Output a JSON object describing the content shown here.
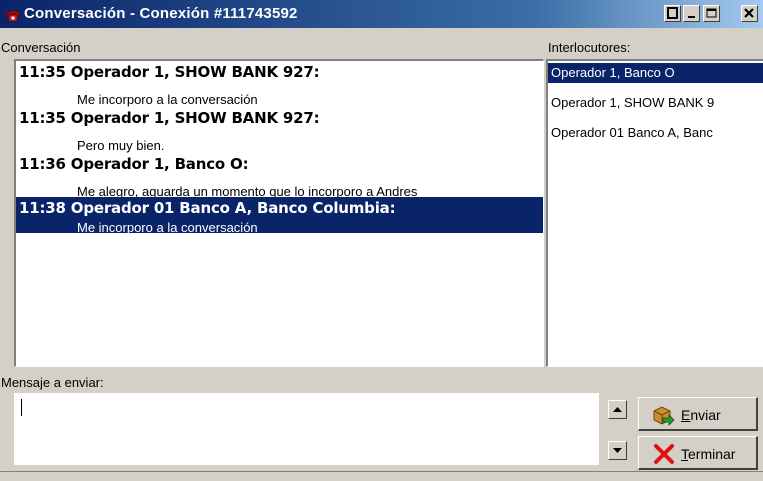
{
  "window": {
    "title": "Conversación - Conexión #111743592",
    "controls": [
      "minimize",
      "restore",
      "maximize",
      "close"
    ]
  },
  "conversation": {
    "label": "Conversación",
    "messages": [
      {
        "time": "11:35",
        "header": "11:35 Operador 1, SHOW BANK 927:",
        "text": "Me incorporo a la conversación",
        "selected": false
      },
      {
        "time": "11:35",
        "header": "11:35 Operador 1, SHOW BANK 927:",
        "text": "Pero muy bien.",
        "selected": false
      },
      {
        "time": "11:36",
        "header": "11:36 Operador 1, Banco O:",
        "text": "Me alegro, aguarda un momento que lo incorporo a Andres",
        "selected": false
      },
      {
        "time": "11:38",
        "header": "11:38 Operador 01 Banco A, Banco Columbia:",
        "text": "Me incorporo a la conversación",
        "selected": true
      }
    ]
  },
  "participants": {
    "label": "Interlocutores:",
    "items": [
      {
        "label": "Operador 1, Banco O",
        "selected": true
      },
      {
        "label": "Operador 1, SHOW BANK 9",
        "selected": false
      },
      {
        "label": "Operador 01 Banco A, Banc",
        "selected": false
      }
    ]
  },
  "compose": {
    "label": "Mensaje a enviar:",
    "value": ""
  },
  "buttons": {
    "send": "Enviar",
    "end": "Terminar"
  },
  "colors": {
    "title_bar": "#0a246a",
    "selection": "#0a246a",
    "face": "#d4d0c8"
  },
  "icons": [
    "telephone-icon",
    "scroll-up-icon",
    "scroll-down-icon",
    "package-send-icon",
    "red-x-icon"
  ]
}
